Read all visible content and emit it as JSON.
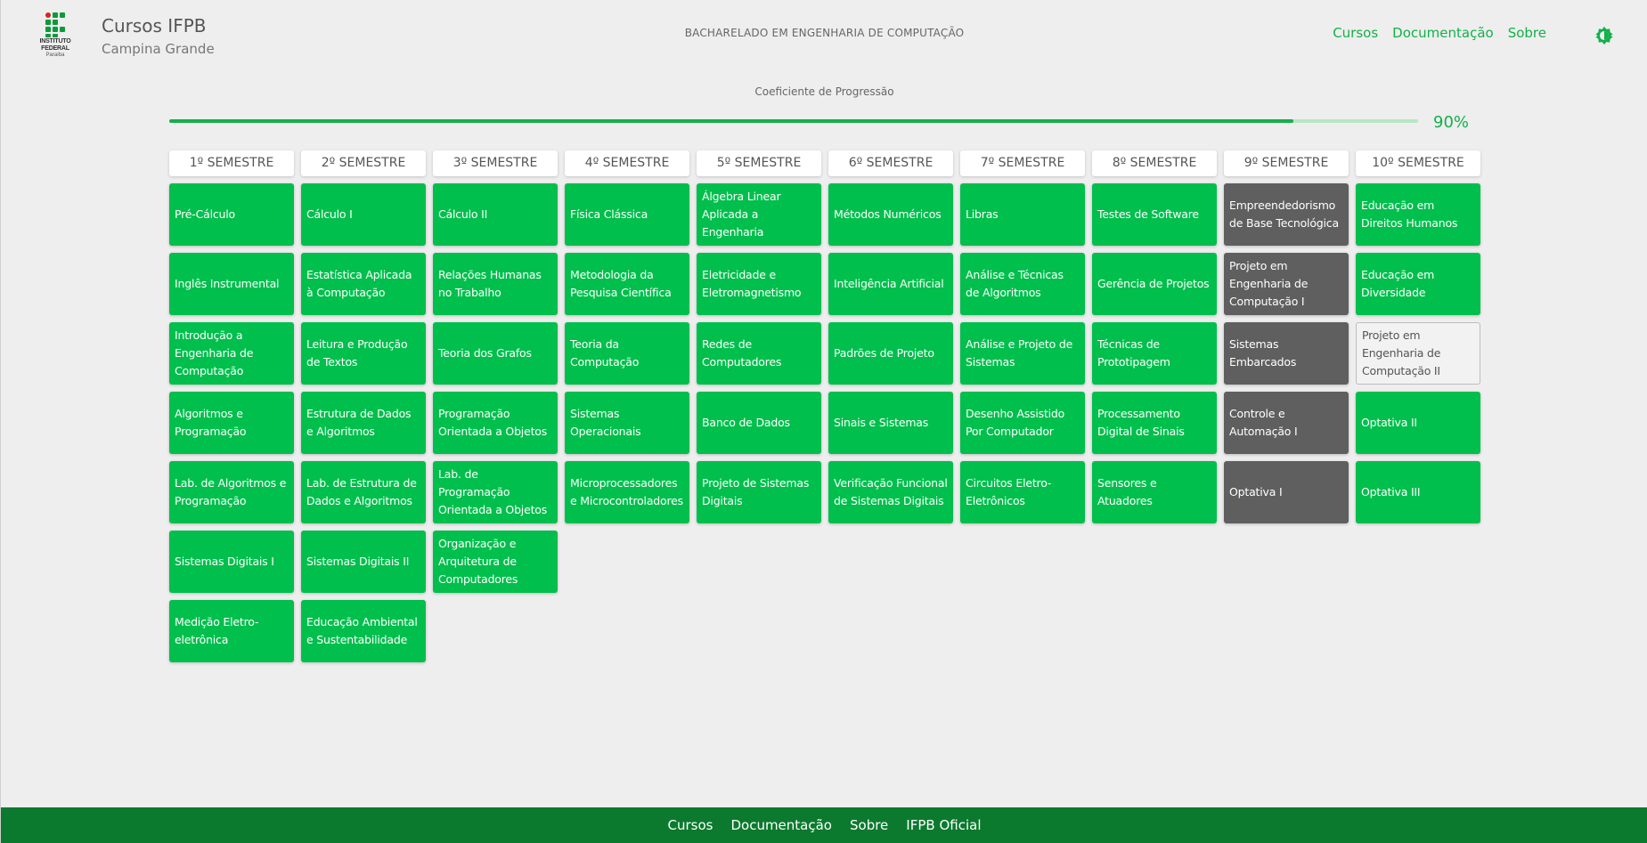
{
  "header": {
    "title": "Cursos IFPB",
    "subtitle": "Campina Grande",
    "course": "BACHARELADO EM ENGENHARIA DE COMPUTAÇÃO",
    "logo_line1": "INSTITUTO FEDERAL",
    "logo_line2": "Paraíba",
    "nav": [
      "Cursos",
      "Documentação",
      "Sobre"
    ],
    "theme_icon": "theme-toggle-icon"
  },
  "progress": {
    "label": "Coeficiente de Progressão",
    "value_text": "90%",
    "fraction": 0.9
  },
  "colors": {
    "done": "#00bf4c",
    "current": "#5f5f5f",
    "pending": "#f2f2f2",
    "accent": "#13b04a",
    "footer": "#0b7a2e"
  },
  "semesters": [
    {
      "label": "1º SEMESTRE",
      "courses": [
        {
          "name": "Pré-Cálculo",
          "status": "done"
        },
        {
          "name": "Inglês Instrumental",
          "status": "done"
        },
        {
          "name": "Introdução a Engenharia de Computação",
          "status": "done"
        },
        {
          "name": "Algoritmos e Programação",
          "status": "done"
        },
        {
          "name": "Lab. de Algoritmos e Programação",
          "status": "done"
        },
        {
          "name": "Sistemas Digitais I",
          "status": "done"
        },
        {
          "name": "Medição Eletro-eletrônica",
          "status": "done"
        }
      ]
    },
    {
      "label": "2º SEMESTRE",
      "courses": [
        {
          "name": "Cálculo I",
          "status": "done"
        },
        {
          "name": "Estatística Aplicada à Computação",
          "status": "done"
        },
        {
          "name": "Leitura e Produção de Textos",
          "status": "done"
        },
        {
          "name": "Estrutura de Dados e Algoritmos",
          "status": "done"
        },
        {
          "name": "Lab. de Estrutura de Dados e Algoritmos",
          "status": "done"
        },
        {
          "name": "Sistemas Digitais II",
          "status": "done"
        },
        {
          "name": "Educação Ambiental e Sustentabilidade",
          "status": "done"
        }
      ]
    },
    {
      "label": "3º SEMESTRE",
      "courses": [
        {
          "name": "Cálculo II",
          "status": "done"
        },
        {
          "name": "Relações Humanas no Trabalho",
          "status": "done"
        },
        {
          "name": "Teoria dos Grafos",
          "status": "done"
        },
        {
          "name": "Programação Orientada a Objetos",
          "status": "done"
        },
        {
          "name": "Lab. de Programação Orientada a Objetos",
          "status": "done"
        },
        {
          "name": "Organização e Arquitetura de Computadores",
          "status": "done"
        }
      ]
    },
    {
      "label": "4º SEMESTRE",
      "courses": [
        {
          "name": "Física Clássica",
          "status": "done"
        },
        {
          "name": "Metodologia da Pesquisa Científica",
          "status": "done"
        },
        {
          "name": "Teoria da Computação",
          "status": "done"
        },
        {
          "name": "Sistemas Operacionais",
          "status": "done"
        },
        {
          "name": "Microprocessadores e Microcontroladores",
          "status": "done"
        }
      ]
    },
    {
      "label": "5º SEMESTRE",
      "courses": [
        {
          "name": "Álgebra Linear Aplicada a Engenharia",
          "status": "done"
        },
        {
          "name": "Eletricidade e Eletromagnetismo",
          "status": "done"
        },
        {
          "name": "Redes de Computadores",
          "status": "done"
        },
        {
          "name": "Banco de Dados",
          "status": "done"
        },
        {
          "name": "Projeto de Sistemas Digitais",
          "status": "done"
        }
      ]
    },
    {
      "label": "6º SEMESTRE",
      "courses": [
        {
          "name": "Métodos Numéricos",
          "status": "done"
        },
        {
          "name": "Inteligência Artificial",
          "status": "done"
        },
        {
          "name": "Padrões de Projeto",
          "status": "done"
        },
        {
          "name": "Sinais e Sistemas",
          "status": "done"
        },
        {
          "name": "Verificação Funcional de Sistemas Digitais",
          "status": "done"
        }
      ]
    },
    {
      "label": "7º SEMESTRE",
      "courses": [
        {
          "name": "Libras",
          "status": "done"
        },
        {
          "name": "Análise e Técnicas de Algoritmos",
          "status": "done"
        },
        {
          "name": "Análise e Projeto de Sistemas",
          "status": "done"
        },
        {
          "name": "Desenho Assistido Por Computador",
          "status": "done"
        },
        {
          "name": "Circuitos Eletro-Eletrônicos",
          "status": "done"
        }
      ]
    },
    {
      "label": "8º SEMESTRE",
      "courses": [
        {
          "name": "Testes de Software",
          "status": "done"
        },
        {
          "name": "Gerência de Projetos",
          "status": "done"
        },
        {
          "name": "Técnicas de Prototipagem",
          "status": "done"
        },
        {
          "name": "Processamento Digital de Sinais",
          "status": "done"
        },
        {
          "name": "Sensores e Atuadores",
          "status": "done"
        }
      ]
    },
    {
      "label": "9º SEMESTRE",
      "courses": [
        {
          "name": "Empreendedorismo de Base Tecnológica",
          "status": "current"
        },
        {
          "name": "Projeto em Engenharia de Computação I",
          "status": "current"
        },
        {
          "name": "Sistemas Embarcados",
          "status": "current"
        },
        {
          "name": "Controle e Automação I",
          "status": "current"
        },
        {
          "name": "Optativa I",
          "status": "current"
        }
      ]
    },
    {
      "label": "10º SEMESTRE",
      "courses": [
        {
          "name": "Educação em Direitos Humanos",
          "status": "done"
        },
        {
          "name": "Educação em Diversidade",
          "status": "done"
        },
        {
          "name": "Projeto em Engenharia de Computação II",
          "status": "pending"
        },
        {
          "name": "Optativa II",
          "status": "done"
        },
        {
          "name": "Optativa III",
          "status": "done"
        }
      ]
    }
  ],
  "footer": {
    "links": [
      "Cursos",
      "Documentação",
      "Sobre",
      "IFPB Oficial"
    ]
  }
}
